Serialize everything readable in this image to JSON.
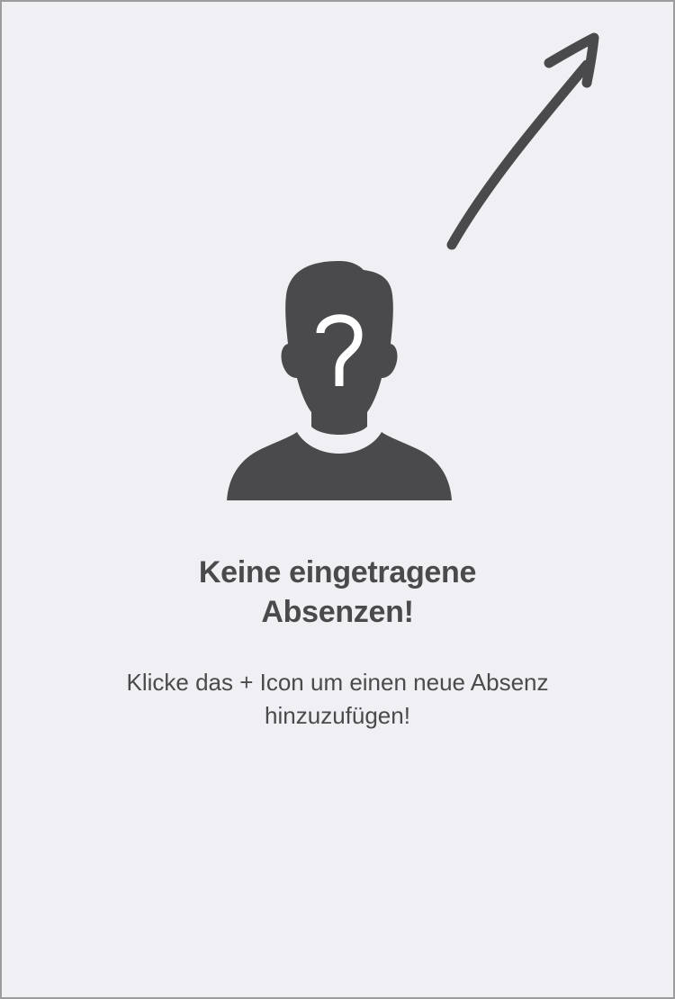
{
  "colors": {
    "background": "#f0eff4",
    "foreground": "#4a4a4c",
    "border": "#9c9c9e"
  },
  "hint": {
    "icon": "arrow-up-right-icon"
  },
  "empty_state": {
    "icon": "unknown-person-icon",
    "title_line1": "Keine eingetragene",
    "title_line2": "Absenzen!",
    "message_line1": "Klicke das + Icon um einen neue Absenz",
    "message_line2": "hinzuzufügen!"
  }
}
